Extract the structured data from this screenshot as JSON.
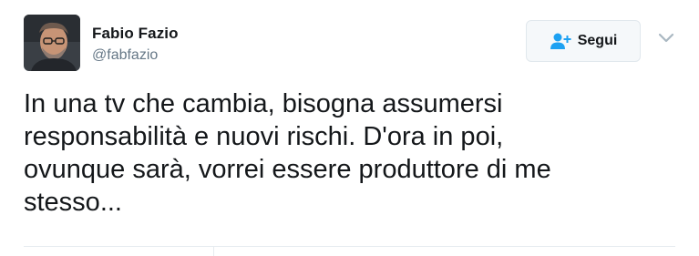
{
  "author": {
    "name": "Fabio Fazio",
    "handle": "@fabfazio",
    "avatar_icon": "profile-photo"
  },
  "follow_button": {
    "label": "Segui",
    "icon": "add-user-icon",
    "color": "#1da1f2"
  },
  "menu": {
    "icon": "chevron-down-icon"
  },
  "tweet": {
    "text": "In una tv che cambia, bisogna assumersi\nresponsabilità e nuovi rischi. D'ora in poi,\novunque sarà, vorrei essere produttore di me\nstesso..."
  }
}
